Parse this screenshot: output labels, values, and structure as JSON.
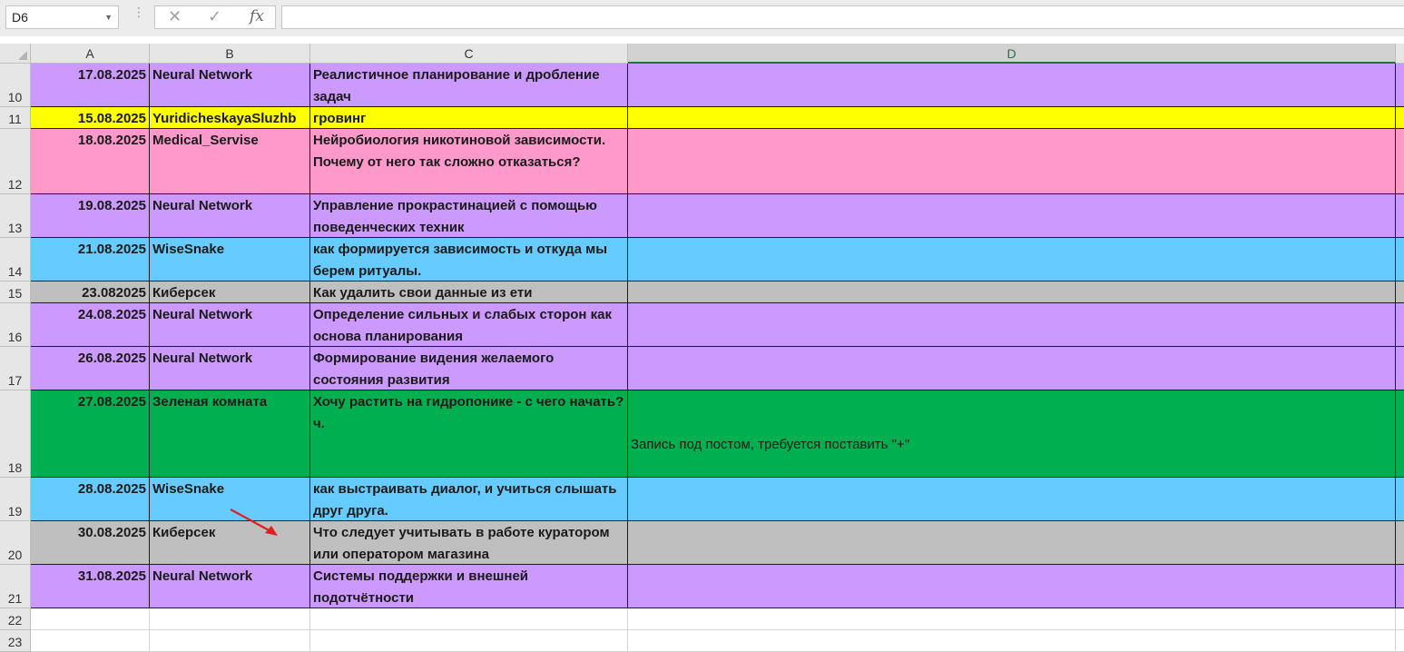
{
  "formula_bar": {
    "name_box": "D6",
    "cancel_icon": "✕",
    "enter_icon": "✓",
    "fx_label": "fx",
    "formula": ""
  },
  "columns": [
    "A",
    "B",
    "C",
    "D"
  ],
  "rows": [
    {
      "num": "10",
      "date": "17.08.2025",
      "source": "Neural Network",
      "topic": "Реалистичное планирование и дробление задач",
      "note": "",
      "color": "#cc99ff"
    },
    {
      "num": "11",
      "date": "15.08.2025",
      "source": "YuridicheskayaSluzhb",
      "topic": "гровинг",
      "note": "",
      "color": "#ffff00"
    },
    {
      "num": "12",
      "date": "18.08.2025",
      "source": "Medical_Servise",
      "topic": "Нейробиология никотиновой зависимости. Почему от него так сложно отказаться?",
      "note": "",
      "color": "#ff99cc"
    },
    {
      "num": "13",
      "date": "19.08.2025",
      "source": "Neural Network",
      "topic": "Управление прокрастинацией с помощью поведенческих техник",
      "note": "",
      "color": "#cc99ff"
    },
    {
      "num": "14",
      "date": "21.08.2025",
      "source": "WiseSnake",
      "topic": "как формируется зависимость и откуда мы берем ритуалы.",
      "note": "",
      "color": "#66ccff"
    },
    {
      "num": "15",
      "date": "23.082025",
      "source": "Киберсек",
      "topic": "Как удалить свои данные из ети",
      "note": "",
      "color": "#bfbfbf"
    },
    {
      "num": "16",
      "date": "24.08.2025",
      "source": "Neural Network",
      "topic": "Определение сильных и слабых сторон как основа планирования",
      "note": "",
      "color": "#cc99ff"
    },
    {
      "num": "17",
      "date": "26.08.2025",
      "source": "Neural Network",
      "topic": "Формирование видения желаемого состояния развития",
      "note": "",
      "color": "#cc99ff"
    },
    {
      "num": "18",
      "date": "27.08.2025",
      "source": "Зеленая комната",
      "topic": "Хочу растить на гидропонике - с чего начать? ч.",
      "note": "Запись под постом, требуется поставить \"+\"",
      "color": "#00b050"
    },
    {
      "num": "19",
      "date": "28.08.2025",
      "source": "WiseSnake",
      "topic": "как выстраивать диалог, и учиться слышать друг друга.",
      "note": "",
      "color": "#66ccff"
    },
    {
      "num": "20",
      "date": "30.08.2025",
      "source": "Киберсек",
      "topic": "Что следует учитывать в работе куратором или оператором магазина",
      "note": "",
      "color": "#bfbfbf"
    },
    {
      "num": "21",
      "date": "31.08.2025",
      "source": "Neural Network",
      "topic": "Системы поддержки и внешней подотчётности",
      "note": "",
      "color": "#cc99ff"
    },
    {
      "num": "22",
      "date": "",
      "source": "",
      "topic": "",
      "note": "",
      "color": "#ffffff"
    },
    {
      "num": "23",
      "date": "",
      "source": "",
      "topic": "",
      "note": "",
      "color": "#ffffff"
    }
  ]
}
